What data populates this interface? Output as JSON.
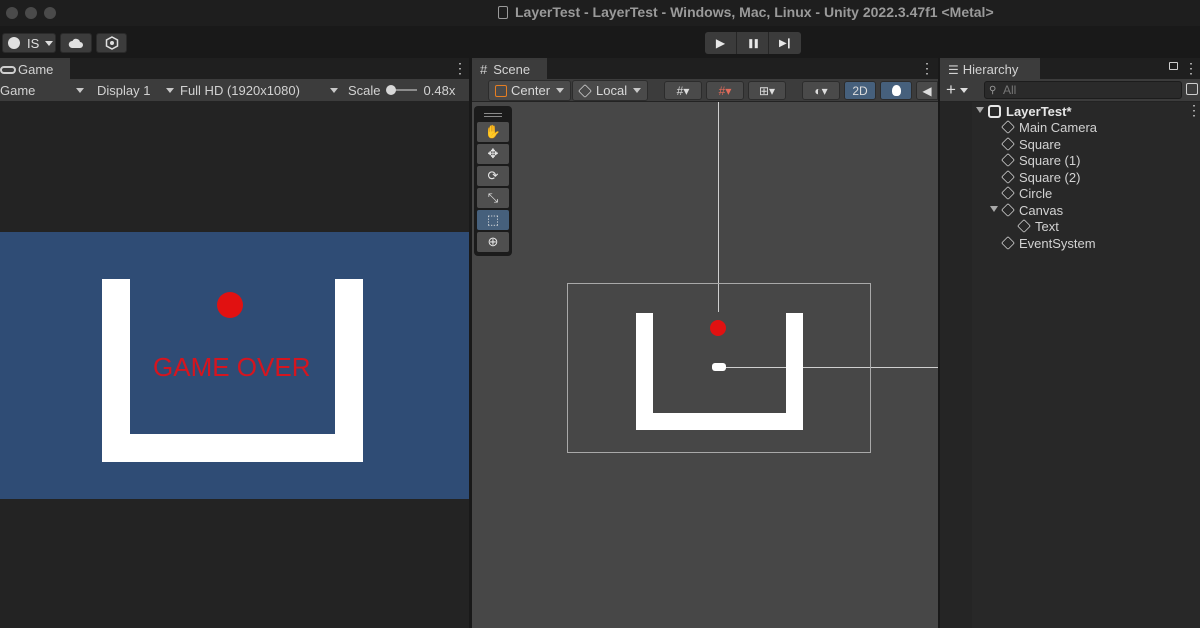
{
  "window": {
    "title": "LayerTest - LayerTest - Windows, Mac, Linux - Unity 2022.3.47f1 <Metal>"
  },
  "toolbar": {
    "account_label": "IS",
    "account_icon": "account-circle-icon",
    "cloud_icon": "cloud-icon",
    "services_icon": "services-icon",
    "play": "▶",
    "pause": "❚❚",
    "step": "▶❙"
  },
  "game": {
    "tab_label": "Game",
    "tab_icon": "gamepad-icon",
    "view_mode": "Game",
    "display": "Display 1",
    "resolution": "Full HD (1920x1080)",
    "scale_label": "Scale",
    "scale_value": "0.48x",
    "overlay_text": "GAME OVER",
    "colors": {
      "background": "#2f4c75",
      "walls": "#ffffff",
      "ball": "#e11111",
      "text": "#d5151f"
    }
  },
  "scene": {
    "tab_label": "Scene",
    "tab_icon": "grid-icon",
    "pivot_mode": "Center",
    "pivot_rotation": "Local",
    "mode_2d": "2D",
    "tools": [
      {
        "name": "hand-tool",
        "glyph": "✋"
      },
      {
        "name": "move-tool",
        "glyph": "✥"
      },
      {
        "name": "rotate-tool",
        "glyph": "⟳"
      },
      {
        "name": "scale-tool",
        "glyph": "⤡"
      },
      {
        "name": "rect-tool",
        "glyph": "⬚"
      },
      {
        "name": "transform-tool",
        "glyph": "⊕"
      }
    ],
    "colors": {
      "background": "#474747",
      "walls": "#ffffff",
      "ball": "#e11111"
    }
  },
  "hierarchy": {
    "tab_label": "Hierarchy",
    "search_placeholder": "All",
    "add_label": "+",
    "root": "LayerTest*",
    "items": [
      "Main Camera",
      "Square",
      "Square (1)",
      "Square (2)",
      "Circle",
      "Canvas",
      "Text",
      "EventSystem"
    ]
  }
}
